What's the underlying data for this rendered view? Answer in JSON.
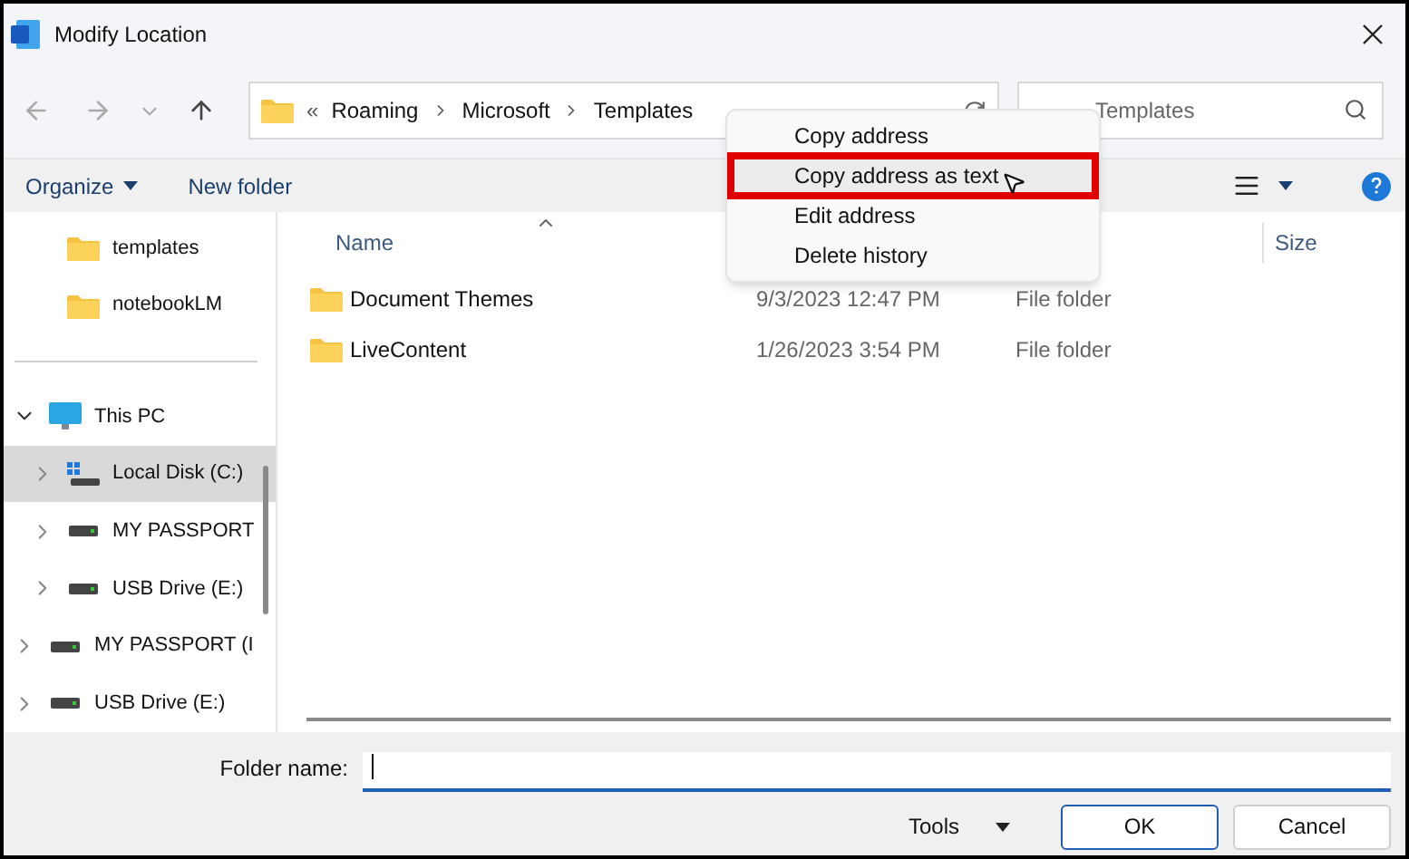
{
  "window": {
    "title": "Modify Location"
  },
  "address": {
    "segments": [
      "«",
      "Roaming",
      "Microsoft",
      "Templates"
    ]
  },
  "search": {
    "placeholder": "Templates"
  },
  "toolbar": {
    "organize": "Organize",
    "new_folder": "New folder"
  },
  "sidebar": {
    "items": [
      {
        "kind": "folder",
        "label": "templates",
        "selected": false
      },
      {
        "kind": "folder",
        "label": "notebookLM",
        "selected": false
      },
      {
        "kind": "pc",
        "label": "This PC",
        "selected": false,
        "expanded": true,
        "children": [
          {
            "kind": "windisk",
            "label": "Local Disk (C:)",
            "selected": true,
            "expanded": false
          },
          {
            "kind": "drive",
            "label": "MY PASSPORT",
            "selected": false,
            "expanded": false
          },
          {
            "kind": "drive",
            "label": "USB Drive (E:)",
            "selected": false,
            "expanded": false
          }
        ]
      },
      {
        "kind": "drive",
        "label": "MY PASSPORT (I",
        "selected": false,
        "expanded": false
      },
      {
        "kind": "drive",
        "label": "USB Drive (E:)",
        "selected": false,
        "expanded": false
      }
    ]
  },
  "table": {
    "columns": [
      "Name",
      "Size"
    ],
    "rows": [
      {
        "name": "Document Themes",
        "date": "9/3/2023 12:47 PM",
        "type": "File folder"
      },
      {
        "name": "LiveContent",
        "date": "1/26/2023 3:54 PM",
        "type": "File folder"
      }
    ]
  },
  "context_menu": {
    "items": [
      {
        "label": "Copy address",
        "selected": false,
        "outlined": false
      },
      {
        "label": "Copy address as text",
        "selected": true,
        "outlined": true
      },
      {
        "label": "Edit address",
        "selected": false,
        "outlined": false
      },
      {
        "label": "Delete history",
        "selected": false,
        "outlined": false
      }
    ]
  },
  "footer": {
    "folder_label": "Folder name:",
    "tools": "Tools",
    "ok": "OK",
    "cancel": "Cancel"
  }
}
